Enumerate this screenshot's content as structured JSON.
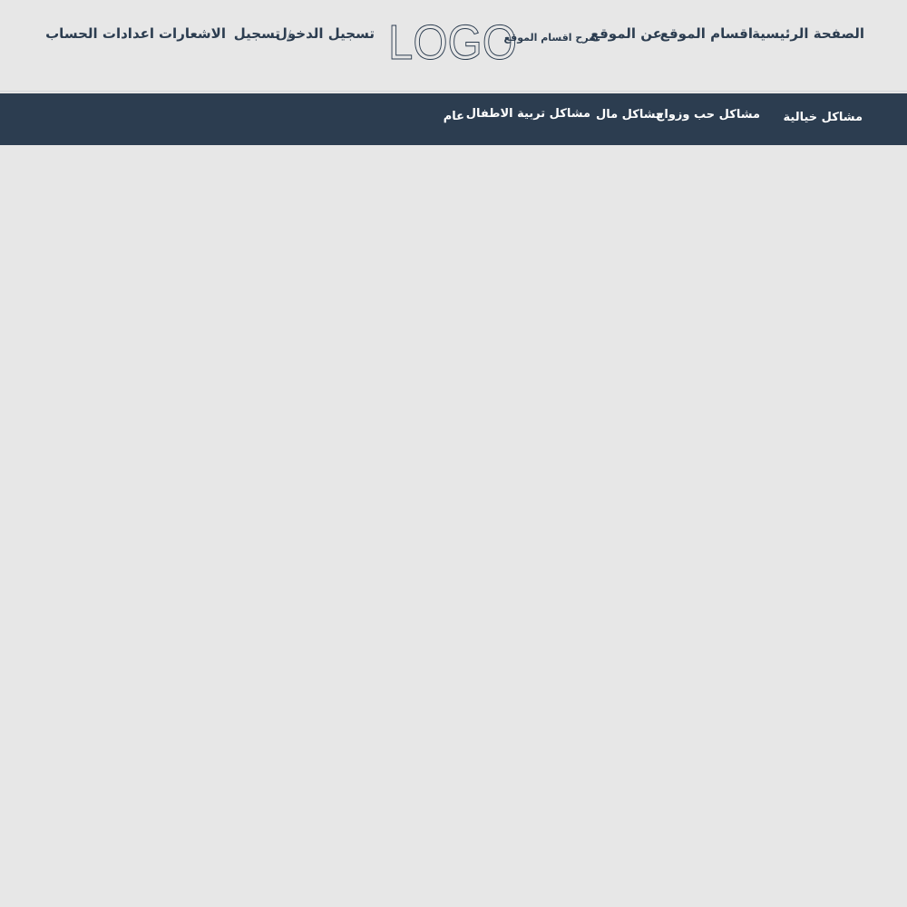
{
  "header": {
    "nav_links": {
      "home": "الصفحة الرئيسية",
      "sections": "اقسام الموقع",
      "about": "عن الموقع",
      "sections_explained": "شرح اقسام الموقع"
    },
    "logo_text": "LOGO",
    "auth": {
      "login": "تسجيل الدخول",
      "separator": "/",
      "register": "تسجيل"
    },
    "notifications": "الاشعارات",
    "account_settings": "اعدادات الحساب"
  },
  "category_nav": {
    "items": [
      "مشاكل خيالية",
      "مشاكل حب وزواج",
      "مشاكل مال",
      "مشاكل تربية الاطفال",
      "عام"
    ]
  },
  "colors": {
    "background": "#e7e7e7",
    "navbar": "#2c3d50",
    "text_dark": "#2c3d50",
    "text_light": "#ffffff"
  }
}
